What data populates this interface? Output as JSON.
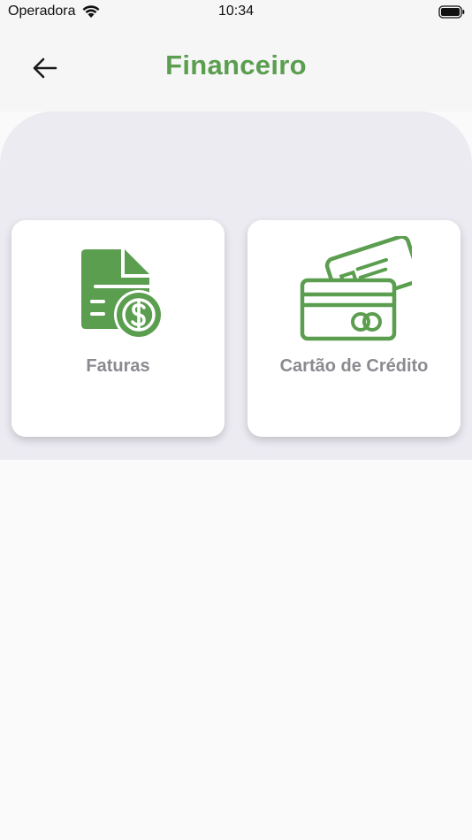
{
  "status_bar": {
    "carrier": "Operadora",
    "time": "10:34"
  },
  "header": {
    "title": "Financeiro"
  },
  "cards": [
    {
      "label": "Faturas",
      "icon": "invoice-dollar-icon"
    },
    {
      "label": "Cartão de Crédito",
      "icon": "credit-cards-icon"
    }
  ],
  "colors": {
    "accent": "#5b9e4f",
    "card_label": "#8a8a90",
    "content_bg": "#ecebf2",
    "header_bg": "#f6f6f6"
  }
}
